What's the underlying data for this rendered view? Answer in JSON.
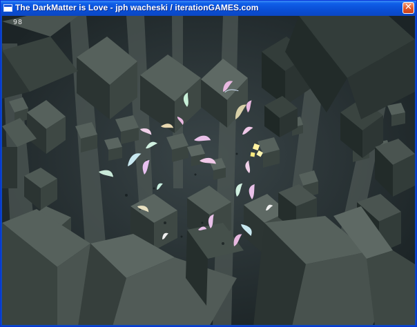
{
  "window": {
    "title": "The DarkMatter is Love - jph wacheski / iterationGAMES.com",
    "close_label": "✕"
  },
  "hud": {
    "counter": "98"
  },
  "colors": {
    "titlebar": "#0b47c3",
    "background": "#2a3537",
    "cube_light": "#56615c",
    "cube_mid": "#3c4642",
    "cube_dark": "#1f2826",
    "pillar": "#4a5450",
    "feather_pink": "#e8b8e0",
    "feather_mint": "#c8f0d8",
    "glow_yellow": "#fff2a0"
  },
  "scene": {
    "icons": [
      "app-window-icon",
      "close-icon"
    ]
  }
}
